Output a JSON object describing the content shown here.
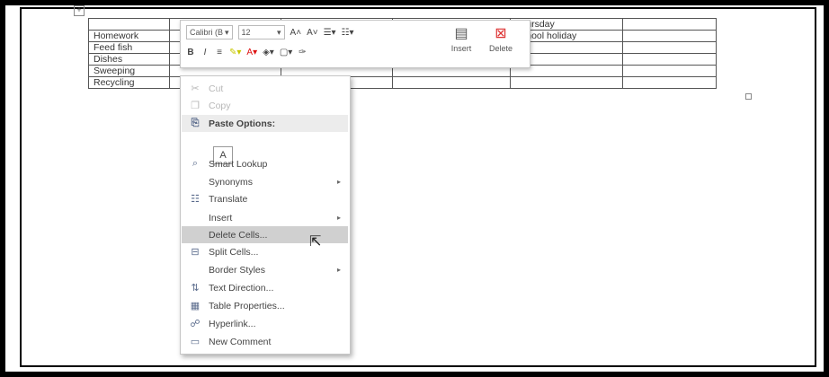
{
  "table": {
    "rows": [
      [
        "",
        "",
        "",
        "",
        "Thursday",
        ""
      ],
      [
        "Homework",
        "",
        "",
        "",
        "School holiday",
        ""
      ],
      [
        "Feed fish",
        "",
        "",
        "",
        "",
        ""
      ],
      [
        "Dishes",
        "",
        "",
        "",
        "",
        ""
      ],
      [
        "Sweeping",
        "",
        "",
        "",
        "",
        ""
      ],
      [
        "Recycling",
        "",
        "",
        "",
        "",
        ""
      ]
    ]
  },
  "mini_toolbar": {
    "font_name": "Calibri (B",
    "font_size": "12",
    "grow_font": "A˄",
    "shrink_font": "A˅",
    "bold": "B",
    "italic": "I",
    "insert_label": "Insert",
    "delete_label": "Delete"
  },
  "context_menu": {
    "items": [
      {
        "label": "Cut",
        "icon": "scissors-icon",
        "glyph": "✂"
      },
      {
        "label": "Copy",
        "icon": "copy-icon",
        "glyph": "❐"
      },
      {
        "label": "Paste Options:",
        "icon": "paste-icon",
        "glyph": "⎘"
      },
      {
        "label": "Smart Lookup",
        "icon": "search-icon",
        "glyph": "⌕"
      },
      {
        "label": "Synonyms",
        "icon": "",
        "glyph": ""
      },
      {
        "label": "Translate",
        "icon": "translate-icon",
        "glyph": "☷"
      },
      {
        "label": "Insert",
        "icon": "",
        "glyph": ""
      },
      {
        "label": "Delete Cells...",
        "icon": "",
        "glyph": ""
      },
      {
        "label": "Split Cells...",
        "icon": "split-cells-icon",
        "glyph": "⊟"
      },
      {
        "label": "Border Styles",
        "icon": "",
        "glyph": ""
      },
      {
        "label": "Text Direction...",
        "icon": "text-direction-icon",
        "glyph": "⇅"
      },
      {
        "label": "Table Properties...",
        "icon": "table-properties-icon",
        "glyph": "▦"
      },
      {
        "label": "Hyperlink...",
        "icon": "hyperlink-icon",
        "glyph": "☍"
      },
      {
        "label": "New Comment",
        "icon": "comment-icon",
        "glyph": "▭"
      }
    ],
    "paste_option_glyph": "A",
    "submenu_arrow": "▸"
  }
}
